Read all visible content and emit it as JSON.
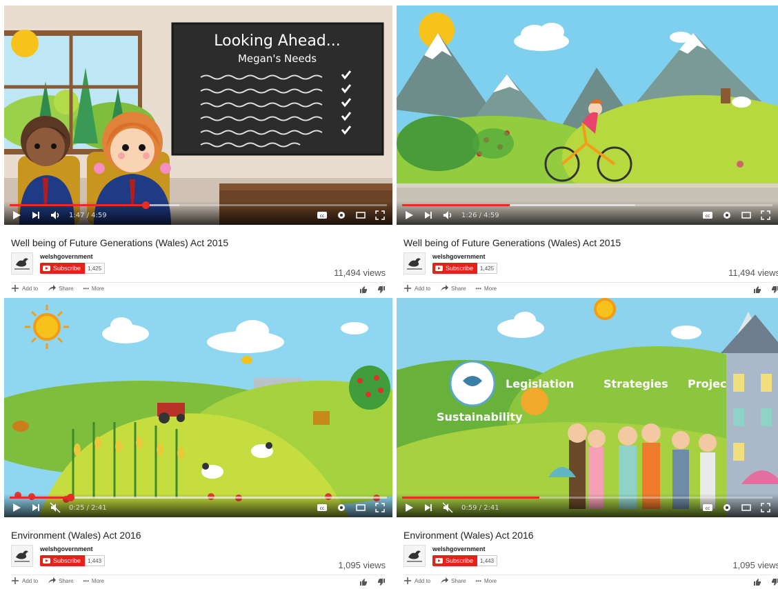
{
  "colors": {
    "accent": "#e52d27",
    "subscribe": "#e62117"
  },
  "panels": [
    {
      "title": "Well being of Future Generations (Wales) Act 2015",
      "channel": "welshgovernment",
      "subscribe_label": "Subscribe",
      "subscriber_count": "1,425",
      "views": "11,494 views",
      "time": "1:47 / 4:59",
      "played_fraction": 0.36,
      "buffered_fraction": 0.45,
      "muted": false,
      "actions": {
        "add": "Add to",
        "share": "Share",
        "more": "More"
      },
      "scene": "classroom",
      "overlay": {
        "board_title": "Looking Ahead...",
        "board_subtitle": "Megan's Needs"
      }
    },
    {
      "title": "Well being of Future Generations (Wales) Act 2015",
      "channel": "welshgovernment",
      "subscribe_label": "Subscribe",
      "subscriber_count": "1,425",
      "views": "11,494 views",
      "time": "1:26 / 4:59",
      "played_fraction": 0.29,
      "buffered_fraction": 0.63,
      "muted": false,
      "actions": {
        "add": "Add to",
        "share": "Share",
        "more": "More"
      },
      "scene": "cycling"
    },
    {
      "title": "Environment (Wales) Act 2016",
      "channel": "welshgovernment",
      "subscribe_label": "Subscribe",
      "subscriber_count": "1,443",
      "views": "1,095 views",
      "time": "0:25 / 2:41",
      "played_fraction": 0.16,
      "buffered_fraction": 1.0,
      "muted": true,
      "actions": {
        "add": "Add to",
        "share": "Share",
        "more": "More"
      },
      "scene": "farm"
    },
    {
      "title": "Environment (Wales) Act 2016",
      "channel": "welshgovernment",
      "subscribe_label": "Subscribe",
      "subscriber_count": "1,443",
      "views": "1,095 views",
      "time": "0:59 / 2:41",
      "played_fraction": 0.37,
      "buffered_fraction": 0.37,
      "muted": true,
      "actions": {
        "add": "Add to",
        "share": "Share",
        "more": "More"
      },
      "scene": "community",
      "overlay": {
        "word1": "Legislation",
        "word2": "Strategies",
        "word3": "Projects",
        "word4": "Sustainability"
      }
    }
  ]
}
